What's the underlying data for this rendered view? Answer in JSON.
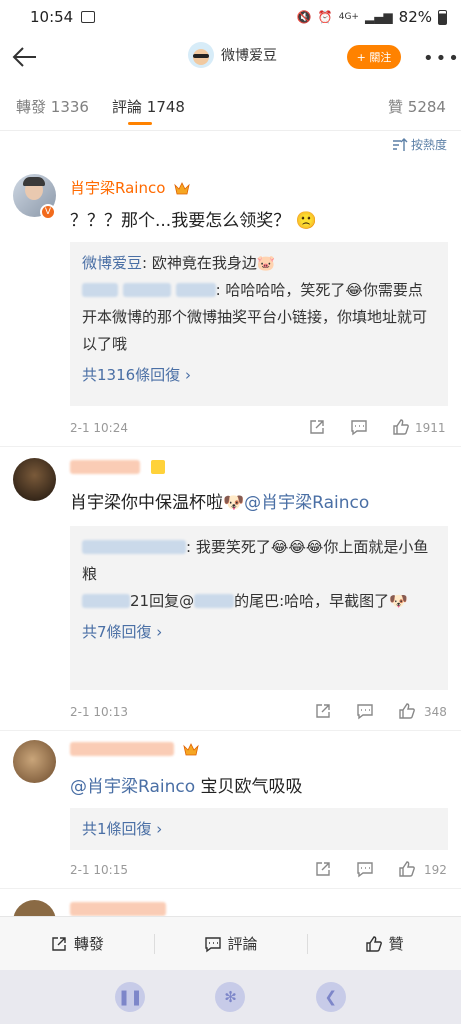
{
  "status": {
    "time": "10:54",
    "signal_label": "4G+",
    "battery": "82%"
  },
  "nav": {
    "title": "微博爱豆",
    "follow_label": "+ 關注"
  },
  "tabs": [
    {
      "label": "轉發",
      "count": "1336"
    },
    {
      "label": "評論",
      "count": "1748"
    },
    {
      "label": "贊",
      "count": "5284"
    }
  ],
  "sort_label": "按熱度",
  "comments": [
    {
      "name": "肖宇梁Rainco",
      "content": "？？？那个...我要怎么领奖？",
      "replies": [
        {
          "name": "微博爱豆",
          "text": ": 欧神竟在我身边"
        },
        {
          "name": "",
          "text": ": 哈哈哈哈，笑死了"
        },
        {
          "name": "",
          "text": "你需要点开本微博的那个微博抽奖平台小链接，你填地址就可以了哦"
        }
      ],
      "more": "共1316條回復 ›",
      "date": "2-1 10:24",
      "likes": "1911"
    },
    {
      "name": "",
      "content": "肖宇梁你中保温杯啦",
      "mention": "@肖宇梁Rainco",
      "replies": [
        {
          "name": "",
          "text": ": 我要笑死了"
        },
        {
          "name": "",
          "text": "你上面就是小鱼粮"
        },
        {
          "name": "",
          "text": "21回复@"
        },
        {
          "name": "",
          "text": "的尾巴:哈哈，早截图了"
        }
      ],
      "more": "共7條回復 ›",
      "date": "2-1 10:13",
      "likes": "348"
    },
    {
      "name": "",
      "mention": "@肖宇梁Rainco",
      "content": " 宝贝欧气吸吸",
      "more": "共1條回復 ›",
      "date": "2-1 10:15",
      "likes": "192"
    }
  ],
  "bottom": {
    "repost": "轉發",
    "comment": "評論",
    "like": "贊"
  },
  "colors": {
    "accent": "#ff8200",
    "link": "#4a6fa5",
    "name": "#ff6a00"
  }
}
